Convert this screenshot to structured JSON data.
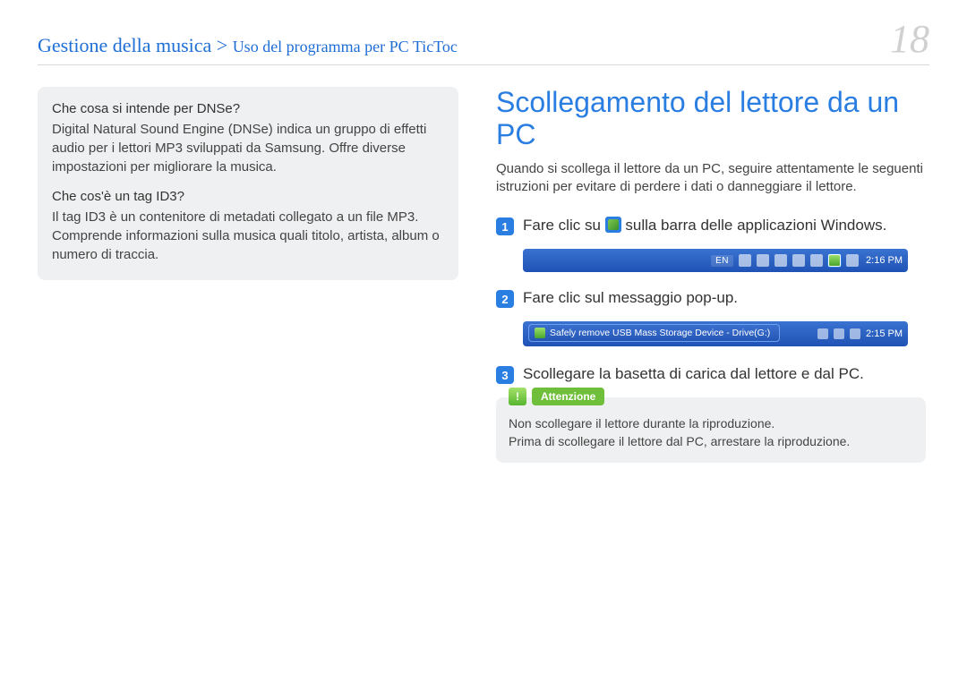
{
  "header": {
    "breadcrumb_main": "Gestione della musica > ",
    "breadcrumb_sub": "Uso del programma per PC TicToc",
    "page_number": "18"
  },
  "left": {
    "q1": "Che cosa si intende per DNSe?",
    "a1": "Digital Natural Sound Engine (DNSe) indica un gruppo di effetti audio per i lettori MP3 sviluppati da Samsung. Offre diverse impostazioni per migliorare la musica.",
    "q2": "Che cos'è un tag ID3?",
    "a2": "Il tag ID3 è un contenitore di metadati collegato a un file MP3. Comprende informazioni sulla musica quali titolo, artista, album o numero di traccia."
  },
  "right": {
    "title": "Scollegamento del lettore da un PC",
    "intro": "Quando si scollega il lettore da un PC, seguire attentamente le seguenti istruzioni per evitare di perdere i dati o danneggiare il lettore.",
    "step1_pre": "Fare clic su ",
    "step1_post": " sulla barra delle applicazioni Windows.",
    "step2": "Fare clic sul messaggio pop-up.",
    "step3": "Scollegare la basetta di carica dal lettore e dal PC.",
    "taskbar1": {
      "lang": "EN",
      "time": "2:16 PM"
    },
    "balloon_text": "Safely remove USB Mass Storage Device - Drive(G:)",
    "taskbar2_time": "2:15 PM",
    "caution_label": "Attenzione",
    "caution_line1": "Non scollegare il lettore durante la riproduzione.",
    "caution_line2": "Prima di scollegare il lettore dal PC, arrestare la riproduzione."
  }
}
